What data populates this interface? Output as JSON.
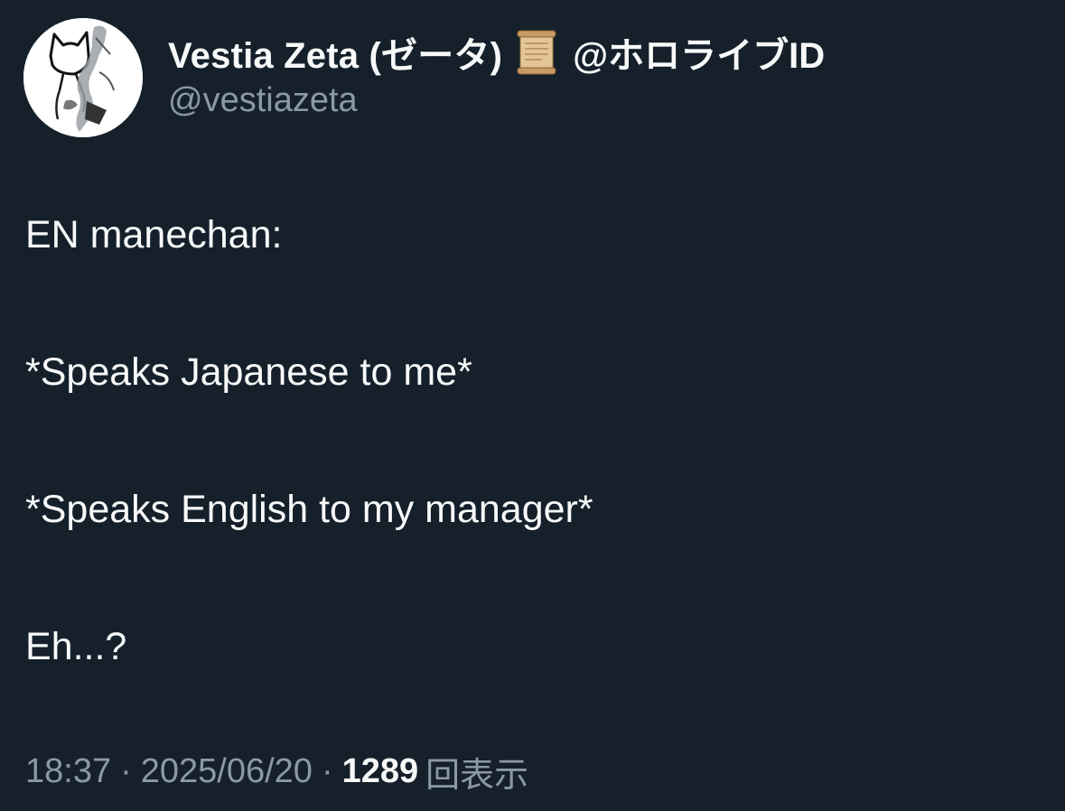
{
  "author": {
    "display_name": "Vestia Zeta (ゼータ)",
    "badge_emoji": "scroll-emoji",
    "name_suffix": "@ホロライブID",
    "handle": "@vestiazeta"
  },
  "tweet": {
    "lines": [
      "EN manechan:",
      "*Speaks Japanese to me*",
      "*Speaks English to my manager*",
      "Eh...?"
    ]
  },
  "meta": {
    "time": "18:37",
    "separator": "·",
    "date": "2025/06/20",
    "views_count": "1289",
    "views_label": "回表示"
  },
  "colors": {
    "background": "#15202b",
    "primary_text": "#f7f9f9",
    "secondary_text": "#8b98a5"
  }
}
